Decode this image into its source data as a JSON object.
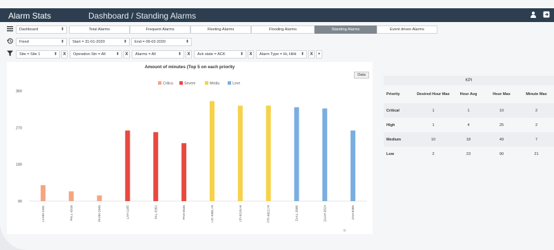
{
  "app": {
    "title": "Alarm Stats",
    "breadcrumb": "Dashboard / Standing Alarms"
  },
  "toolbar": {
    "dashboard_select": "Dashboard",
    "time_mode_select": "Fixed",
    "start_date": "Start = 31-01-2020",
    "end_date": "End = 06-02-2020"
  },
  "tabs": [
    {
      "label": "Total Alarms",
      "active": false
    },
    {
      "label": "Frequent Alarms",
      "active": false
    },
    {
      "label": "Fleeting Alarms",
      "active": false
    },
    {
      "label": "Flooding Alarms",
      "active": false
    },
    {
      "label": "Standing Alarms",
      "active": true
    },
    {
      "label": "Event driven Alarms",
      "active": false
    }
  ],
  "filters": {
    "site": "Site = Site 1",
    "operator": "Operation Stn = All",
    "alarms": "Alarms = All",
    "ack_state": "Ack state = ACK",
    "alarm_type": "Alarm Type = Hi, HiHi",
    "add": "+"
  },
  "chart": {
    "data_button": "Data"
  },
  "chart_data": {
    "type": "bar",
    "title": "Amount of minutes (Top 5 on each priority",
    "legend": [
      "Critica",
      "Severe",
      "Media",
      "Leve"
    ],
    "legend_colors": [
      "#f4a582",
      "#e8493f",
      "#f6d24a",
      "#7aaee0"
    ],
    "categories": [
      "LAHH-2331",
      "PALL-4318",
      "PAHH-2846",
      "LAH-1165",
      "PAL-5352",
      "PAH-0535",
      "LIC-0381.HI",
      "LTI-5215.HI",
      "PTI-9822.HI",
      "ZAAL-3986",
      "ZAAH-3524",
      "ZAH-6385"
    ],
    "priority": [
      "Critica",
      "Critica",
      "Critica",
      "Severe",
      "Severe",
      "Severe",
      "Media",
      "Media",
      "Media",
      "Leve",
      "Leve",
      "Leve"
    ],
    "values": [
      129,
      114,
      104,
      263,
      259,
      232,
      335,
      324,
      324,
      320,
      317,
      263
    ],
    "ylim": [
      90,
      360
    ],
    "yticks": [
      90,
      180,
      270,
      360
    ],
    "xlabel": "D",
    "grid": false,
    "legend_position": "top"
  },
  "kpi": {
    "title": "KPI",
    "columns": [
      "Priority",
      "Desired Hour Max",
      "Hour Avg",
      "Hour Max",
      "Minute Max"
    ],
    "rows": [
      [
        "Critical",
        "1",
        "1",
        "10",
        "2"
      ],
      [
        "High",
        "1",
        "4",
        "25",
        "2"
      ],
      [
        "Medium",
        "10",
        "18",
        "49",
        "7"
      ],
      [
        "Low",
        "2",
        "23",
        "90",
        "21"
      ]
    ]
  }
}
